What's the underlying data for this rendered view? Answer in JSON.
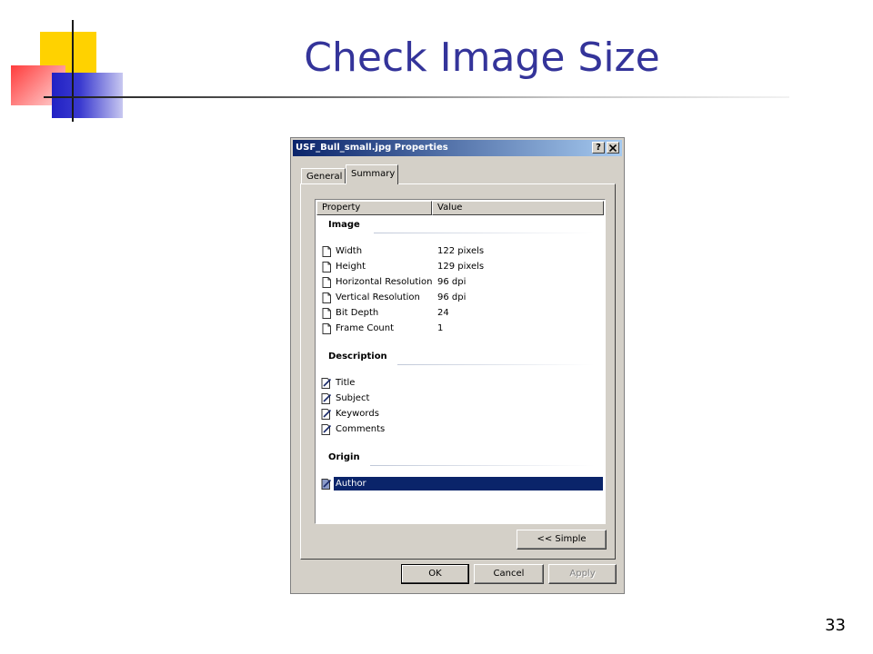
{
  "slide": {
    "title": "Check Image Size",
    "page_number": "33"
  },
  "dialog": {
    "title": "USF_Bull_small.jpg Properties",
    "help_button": "?",
    "close_button": "✕",
    "tabs": [
      {
        "label": "General",
        "active": false
      },
      {
        "label": "Summary",
        "active": true
      }
    ],
    "columns": {
      "property": "Property",
      "value": "Value"
    },
    "groups": {
      "image": "Image",
      "description": "Description",
      "origin": "Origin"
    },
    "image_rows": [
      {
        "property": "Width",
        "value": "122 pixels",
        "icon": "document-icon"
      },
      {
        "property": "Height",
        "value": "129 pixels",
        "icon": "document-icon"
      },
      {
        "property": "Horizontal Resolution",
        "value": "96 dpi",
        "icon": "document-icon"
      },
      {
        "property": "Vertical Resolution",
        "value": "96 dpi",
        "icon": "document-icon"
      },
      {
        "property": "Bit Depth",
        "value": "24",
        "icon": "document-icon"
      },
      {
        "property": "Frame Count",
        "value": "1",
        "icon": "document-icon"
      }
    ],
    "description_rows": [
      {
        "property": "Title",
        "value": "",
        "icon": "edit-document-icon"
      },
      {
        "property": "Subject",
        "value": "",
        "icon": "edit-document-icon"
      },
      {
        "property": "Keywords",
        "value": "",
        "icon": "edit-document-icon"
      },
      {
        "property": "Comments",
        "value": "",
        "icon": "edit-document-icon"
      }
    ],
    "origin_rows": [
      {
        "property": "Author",
        "value": "",
        "icon": "edit-document-icon",
        "selected": true
      }
    ],
    "buttons": {
      "simple": "<< Simple",
      "ok": "OK",
      "cancel": "Cancel",
      "apply": "Apply"
    },
    "colors": {
      "titlebar_start": "#0a246a",
      "titlebar_end": "#a6caf0",
      "selection": "#0a246a",
      "face": "#d4d0c8"
    }
  }
}
